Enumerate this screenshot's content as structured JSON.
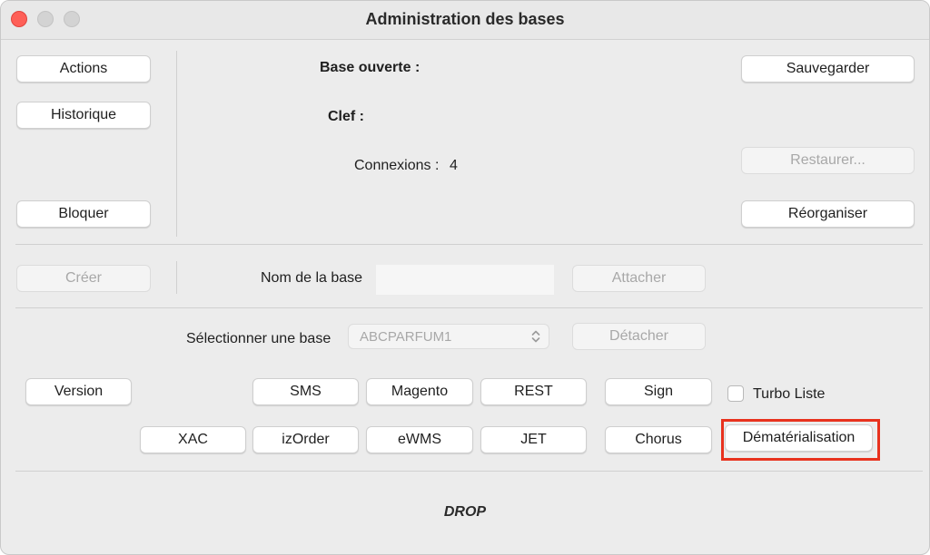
{
  "window": {
    "title": "Administration des bases"
  },
  "left_buttons": {
    "actions": "Actions",
    "historique": "Historique",
    "bloquer": "Bloquer"
  },
  "info": {
    "base_ouverte_label": "Base ouverte :",
    "clef_label": "Clef :",
    "connexions_label": "Connexions :",
    "connexions_value": "4"
  },
  "right_buttons": {
    "sauvegarder": "Sauvegarder",
    "restaurer": "Restaurer...",
    "reorganiser": "Réorganiser"
  },
  "create_row": {
    "creer": "Créer",
    "nom_label": "Nom de la base",
    "nom_value": "",
    "attacher": "Attacher"
  },
  "select_row": {
    "label": "Sélectionner une base",
    "selected": "ABCPARFUM1",
    "detacher": "Détacher"
  },
  "modules_row1": {
    "version": "Version",
    "sms": "SMS",
    "magento": "Magento",
    "rest": "REST",
    "sign": "Sign",
    "turbo_liste": "Turbo Liste"
  },
  "modules_row2": {
    "xac": "XAC",
    "izorder": "izOrder",
    "ewms": "eWMS",
    "jet": "JET",
    "chorus": "Chorus",
    "dematerialisation": "Dématérialisation"
  },
  "footer": {
    "drop": "DROP"
  },
  "colors": {
    "highlight": "#e8321e",
    "close": "#fe5f57"
  }
}
